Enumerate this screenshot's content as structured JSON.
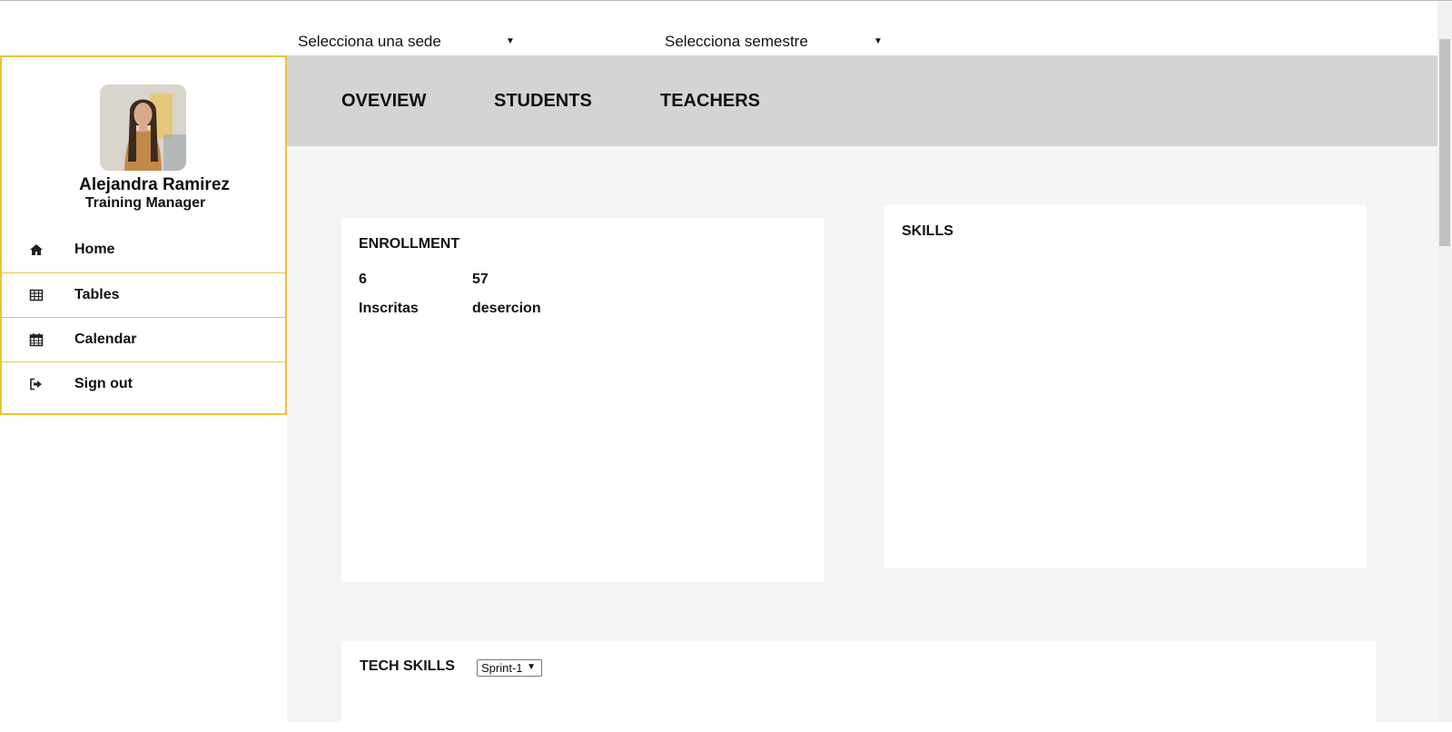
{
  "filters": {
    "sede": {
      "selected": "Selecciona una sede"
    },
    "semestre": {
      "selected": "Selecciona semestre"
    }
  },
  "profile": {
    "name": "Alejandra Ramirez",
    "role": "Training Manager"
  },
  "sidebar": {
    "items": [
      {
        "label": "Home",
        "icon": "home-icon"
      },
      {
        "label": "Tables",
        "icon": "table-icon"
      },
      {
        "label": "Calendar",
        "icon": "calendar-icon"
      },
      {
        "label": "Sign out",
        "icon": "sign-out-icon"
      }
    ]
  },
  "tabs": [
    {
      "label": "OVEVIEW"
    },
    {
      "label": "STUDENTS"
    },
    {
      "label": "TEACHERS"
    }
  ],
  "enrollment": {
    "title": "ENROLLMENT",
    "inscritas_value": "6",
    "inscritas_label": "Inscritas",
    "desercion_value": "57",
    "desercion_label": "desercion"
  },
  "skills": {
    "title": "SKILLS"
  },
  "tech_skills": {
    "title": "TECH SKILLS",
    "sprint_selected": "Sprint-1"
  },
  "colors": {
    "sidebar_border": "#e8c43a",
    "tabs_bar": "#d4d4d4",
    "main_bg": "#f5f5f5"
  }
}
